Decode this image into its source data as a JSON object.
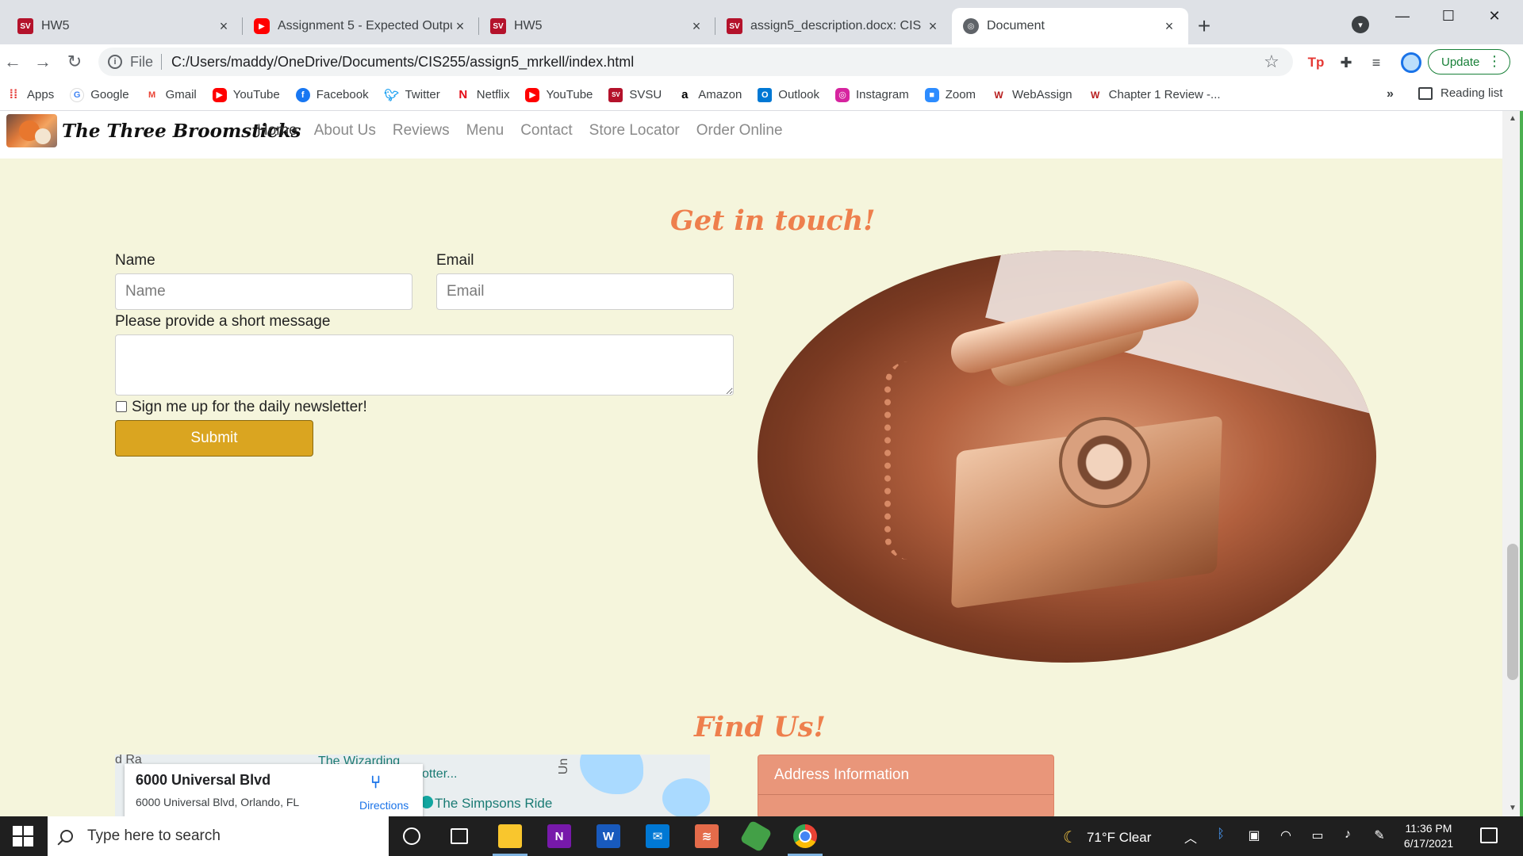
{
  "browser": {
    "tabs": [
      {
        "title": "HW5",
        "favicon": "svsu-icon",
        "active": false
      },
      {
        "title": "Assignment 5 - Expected Output",
        "favicon": "youtube-icon",
        "active": false
      },
      {
        "title": "HW5",
        "favicon": "svsu-icon",
        "active": false
      },
      {
        "title": "assign5_description.docx: CIS 255",
        "favicon": "svsu-icon",
        "active": false
      },
      {
        "title": "Document",
        "favicon": "globe-icon",
        "active": true
      }
    ],
    "address_scheme": "File",
    "address_url": "C:/Users/maddy/OneDrive/Documents/CIS255/assign5_mrkell/index.html",
    "update_label": "Update",
    "bookmarks": [
      {
        "label": "Apps",
        "icon": "apps-grid-icon"
      },
      {
        "label": "Google",
        "icon": "google-icon"
      },
      {
        "label": "Gmail",
        "icon": "gmail-icon"
      },
      {
        "label": "YouTube",
        "icon": "youtube-icon"
      },
      {
        "label": "Facebook",
        "icon": "facebook-icon"
      },
      {
        "label": "Twitter",
        "icon": "twitter-icon"
      },
      {
        "label": "Netflix",
        "icon": "netflix-icon"
      },
      {
        "label": "YouTube",
        "icon": "youtube-icon"
      },
      {
        "label": "SVSU",
        "icon": "svsu-icon"
      },
      {
        "label": "Amazon",
        "icon": "amazon-icon"
      },
      {
        "label": "Outlook",
        "icon": "outlook-icon"
      },
      {
        "label": "Instagram",
        "icon": "instagram-icon"
      },
      {
        "label": "Zoom",
        "icon": "zoom-icon"
      },
      {
        "label": "WebAssign",
        "icon": "webassign-icon"
      },
      {
        "label": "Chapter 1 Review -...",
        "icon": "webassign-icon"
      }
    ],
    "bookmarks_overflow": "»",
    "reading_list": "Reading list"
  },
  "site": {
    "brand": "The Three Broomsticks",
    "nav": [
      {
        "label": "Home",
        "active": true
      },
      {
        "label": "About Us",
        "active": false
      },
      {
        "label": "Reviews",
        "active": false
      },
      {
        "label": "Menu",
        "active": false
      },
      {
        "label": "Contact",
        "active": false
      },
      {
        "label": "Store Locator",
        "active": false
      },
      {
        "label": "Order Online",
        "active": false
      }
    ]
  },
  "contact": {
    "title": "Get in touch!",
    "name_label": "Name",
    "name_placeholder": "Name",
    "email_label": "Email",
    "email_placeholder": "Email",
    "message_label": "Please provide a short message",
    "newsletter_label": "Sign me up for the daily newsletter!",
    "newsletter_checked": false,
    "submit_label": "Submit"
  },
  "find_us": {
    "title": "Find Us!",
    "map": {
      "road_label_1": "d Ra",
      "road_label_2": "Un",
      "poi_1": "The Wizarding",
      "poi_2": "otter...",
      "poi_3": "The Simpsons Ride",
      "card_title": "6000 Universal Blvd",
      "card_address": "6000 Universal Blvd, Orlando, FL",
      "directions_label": "Directions"
    },
    "address_header": "Address Information"
  },
  "taskbar": {
    "search_placeholder": "Type here to search",
    "weather": "71°F  Clear",
    "time": "11:36 PM",
    "date": "6/17/2021"
  },
  "colors": {
    "page_bg": "#f5f5dc",
    "accent_title": "#ee7f4d",
    "submit_bg": "#daa520",
    "address_box": "#e9967a"
  }
}
